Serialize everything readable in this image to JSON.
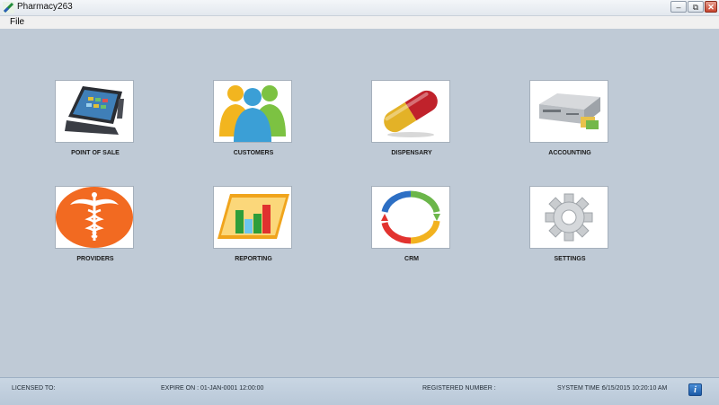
{
  "window": {
    "title": "Pharmacy263",
    "controls": {
      "minimize": "–",
      "restore": "⧉",
      "close": "✕"
    }
  },
  "menu": {
    "file": "File"
  },
  "tiles": [
    {
      "label": "POINT OF SALE",
      "icon": "pos-terminal-icon"
    },
    {
      "label": "CUSTOMERS",
      "icon": "customers-people-icon"
    },
    {
      "label": "DISPENSARY",
      "icon": "pill-capsule-icon"
    },
    {
      "label": "ACCOUNTING",
      "icon": "server-icon"
    },
    {
      "label": "PROVIDERS",
      "icon": "caduceus-icon"
    },
    {
      "label": "REPORTING",
      "icon": "bar-chart-icon"
    },
    {
      "label": "CRM",
      "icon": "crm-cycle-icon"
    },
    {
      "label": "SETTINGS",
      "icon": "gear-icon"
    }
  ],
  "status": {
    "licensed_label": "LICENSED TO:",
    "expire_label": "EXPIRE ON :",
    "expire_value": "01-JAN-0001 12:00:00",
    "registered_label": "REGISTERED NUMBER :",
    "system_time_label": "SYSTEM TIME :",
    "system_time_value": "6/15/2015 10:20:10 AM",
    "info_button": "i"
  },
  "colors": {
    "background": "#bfcad6",
    "providers_orange": "#f26a21",
    "capsule_red": "#c0222b",
    "capsule_yellow": "#e3b227"
  }
}
